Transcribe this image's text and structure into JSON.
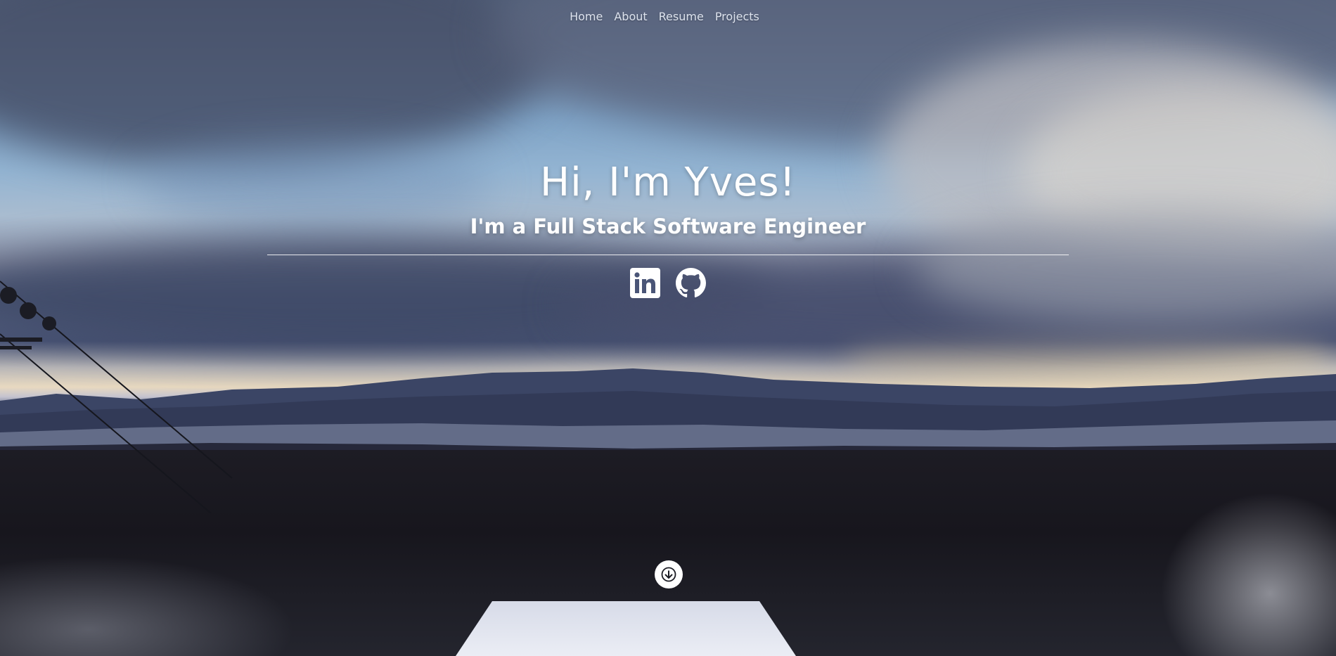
{
  "nav": {
    "items": [
      {
        "label": "Home"
      },
      {
        "label": "About"
      },
      {
        "label": "Resume"
      },
      {
        "label": "Projects"
      }
    ]
  },
  "banner": {
    "title": "Hi, I'm Yves!",
    "subtitle": "I'm a Full Stack Software Engineer"
  },
  "social": {
    "icons": [
      "linkedin-icon",
      "github-icon"
    ]
  },
  "scroll": {
    "icon": "arrow-down-icon"
  },
  "colors": {
    "text": "#ffffff",
    "nav_text": "#dde3ee"
  }
}
